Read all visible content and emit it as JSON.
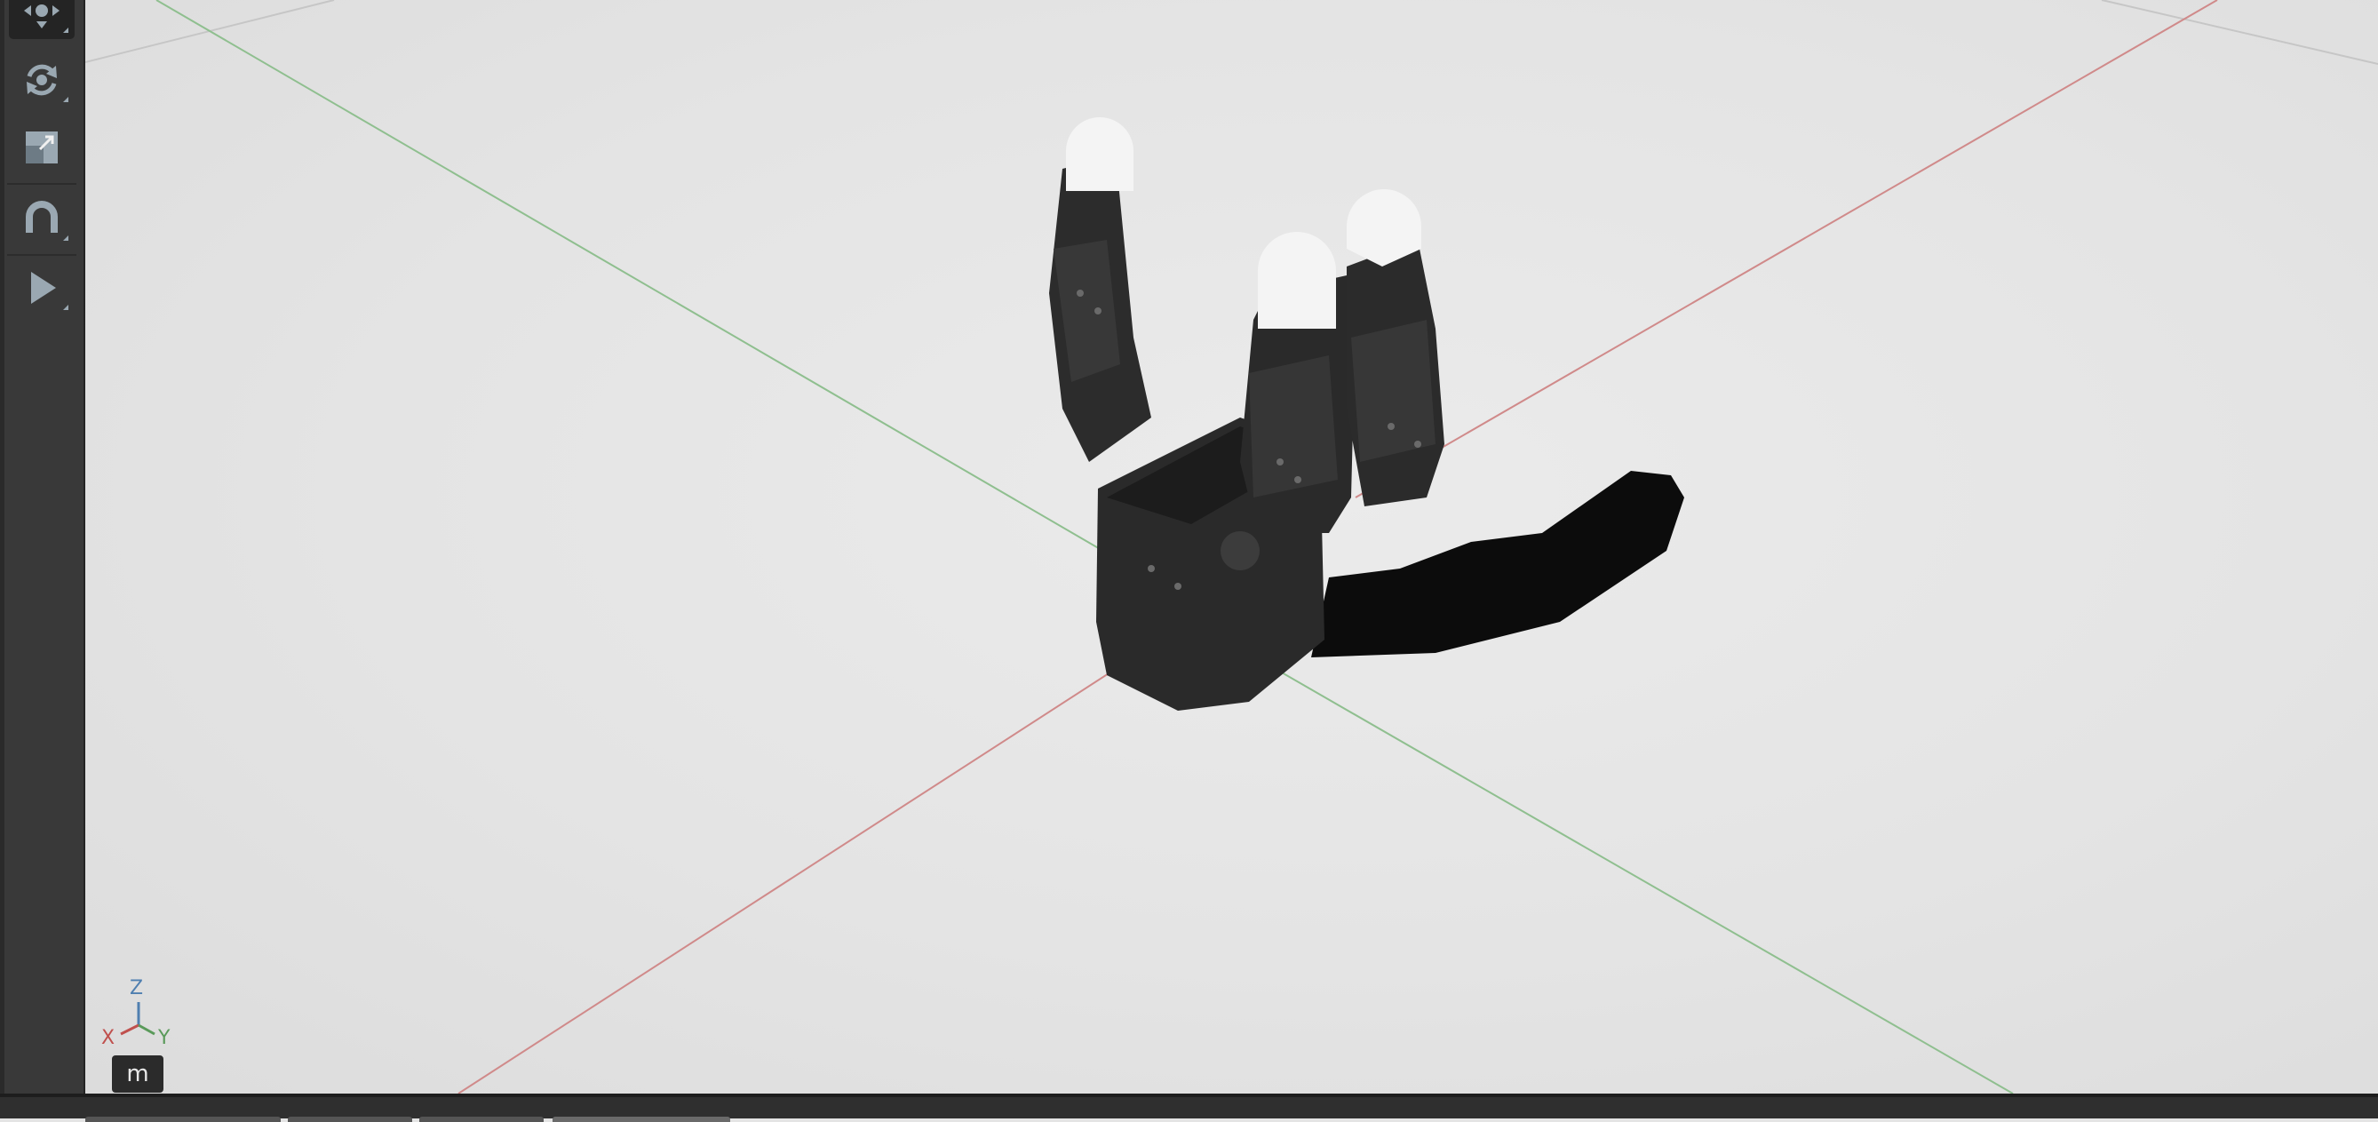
{
  "toolbar": {
    "tools": [
      {
        "name": "move-tool",
        "icon": "move-arrows-icon",
        "active": true
      },
      {
        "name": "rotate-tool",
        "icon": "rotate-icon",
        "active": false
      },
      {
        "name": "scale-tool",
        "icon": "scale-icon",
        "active": false
      },
      {
        "name": "snap-tool",
        "icon": "magnet-icon",
        "active": false
      },
      {
        "name": "play-tool",
        "icon": "play-icon",
        "active": false
      }
    ],
    "icon_color": "#9aa8b2"
  },
  "viewport": {
    "gizmo": {
      "z_label": "Z",
      "x_label": "X",
      "y_label": "Y",
      "colors": {
        "x": "#c0504d",
        "y": "#5a9a5a",
        "z": "#4f7fb0"
      }
    },
    "units_label": "m",
    "grid_colors": {
      "x_axis": "#d08a8a",
      "y_axis": "#8fbf8f",
      "grid": "#c8c8c8"
    },
    "model": "robotic-hand-gripper"
  }
}
